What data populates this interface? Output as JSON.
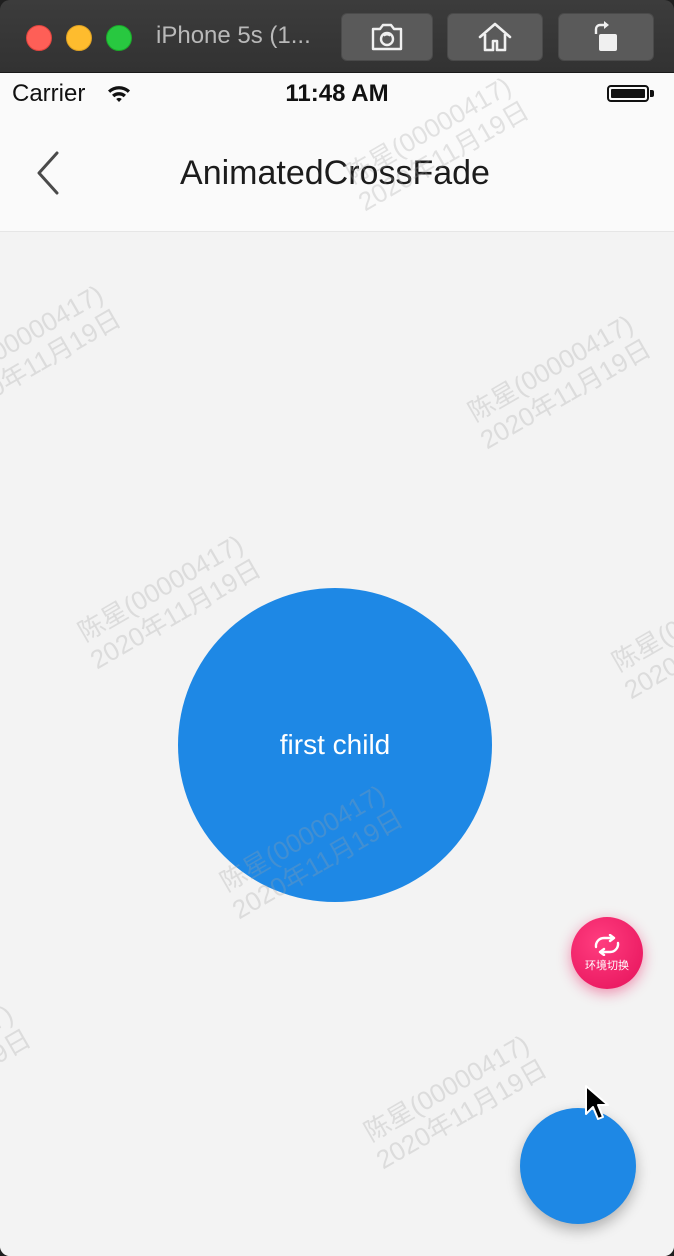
{
  "window": {
    "title": "iPhone 5s (1..."
  },
  "toolbar": {
    "screenshot_icon": "camera-icon",
    "home_icon": "home-icon",
    "rotate_icon": "rotate-icon"
  },
  "statusbar": {
    "carrier": "Carrier",
    "time": "11:48 AM"
  },
  "navbar": {
    "title": "AnimatedCrossFade",
    "back_icon": "chevron-left-icon"
  },
  "content": {
    "child_label": "first child"
  },
  "env_switch": {
    "label": "环境切换",
    "icon": "refresh-icon"
  },
  "watermark": {
    "line1": "陈星(00000417)",
    "line2": "2020年11月19日"
  },
  "colors": {
    "primary": "#1e88e5",
    "env_switch": "#e5115a",
    "screen_background": "#f3f3f3"
  }
}
